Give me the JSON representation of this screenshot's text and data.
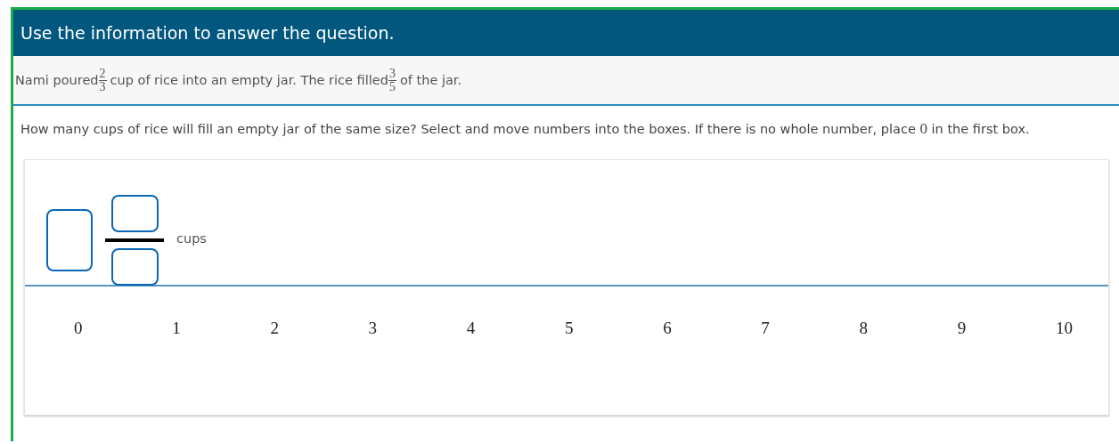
{
  "header": {
    "title": "Use the information to answer the question."
  },
  "info": {
    "segments": [
      {
        "kind": "text",
        "text": "Nami poured"
      },
      {
        "kind": "fraction",
        "numerator": "2",
        "denominator": "3"
      },
      {
        "kind": "text",
        "text": "cup of rice into an empty jar. The rice filled"
      },
      {
        "kind": "fraction",
        "numerator": "3",
        "denominator": "5"
      },
      {
        "kind": "text",
        "text": "of the jar."
      }
    ]
  },
  "question": {
    "segments": [
      {
        "kind": "text",
        "text": "How many cups of rice will fill an empty jar of the same size? Select and move numbers into the boxes. If there is no whole number, place"
      },
      {
        "kind": "math",
        "text": "0"
      },
      {
        "kind": "text",
        "text": "in the first box."
      }
    ]
  },
  "answer": {
    "unit": "cups"
  },
  "tiles": [
    "0",
    "1",
    "2",
    "3",
    "4",
    "5",
    "6",
    "7",
    "8",
    "9",
    "10"
  ]
}
